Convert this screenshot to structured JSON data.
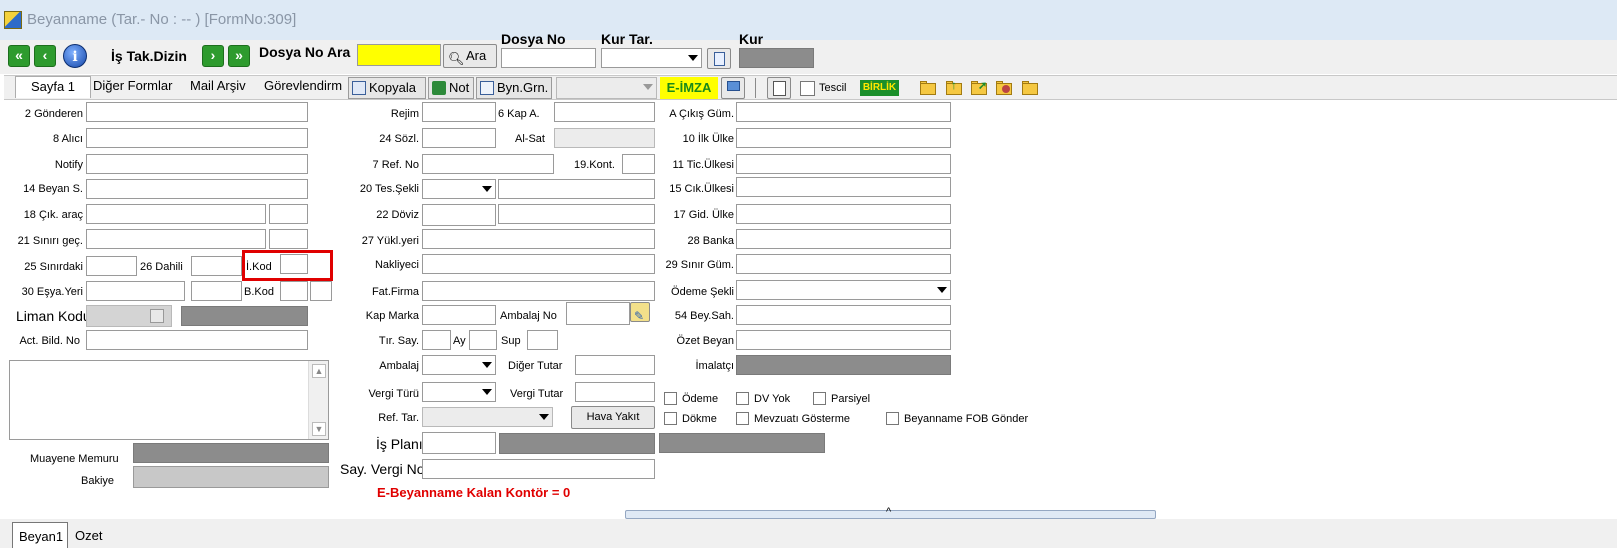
{
  "window": {
    "title": "Beyanname (Tar.- No :  --  )  [FormNo:309]",
    "app_icon_text": "ZIRS"
  },
  "toolbar": {
    "is_tak_dizin": "İş Tak.Dizin",
    "dosya_no_ara_label": "Dosya No Ara",
    "ara_button": "Ara",
    "dosya_no_label": "Dosya No",
    "kur_tar_label": "Kur Tar.",
    "kur_label": "Kur"
  },
  "tabs": [
    {
      "label": "Sayfa 1",
      "active": true
    },
    {
      "label": "Diğer Formlar",
      "active": false
    },
    {
      "label": "Mail Arşiv",
      "active": false
    },
    {
      "label": "Görevlendirm",
      "active": false
    }
  ],
  "tab_buttons": {
    "kopyala": "Kopyala",
    "not": "Not",
    "byn_grn": "Byn.Grn.",
    "eimza": "E-İMZA",
    "tescil": "Tescil",
    "birlik": "BİRLİK"
  },
  "form": {
    "left": {
      "gonderen": "2 Gönderen",
      "alici": "8 Alıcı",
      "notify": "Notify",
      "beyan_s": "14 Beyan S.",
      "cik_arac": "18 Çık. araç",
      "siniri_gec": "21 Sınırı geç.",
      "sinirdaki": "25 Sınırdaki",
      "dahili": "26 Dahili",
      "i_kod": "İ.Kod",
      "esya_yeri": "30 Eşya.Yeri",
      "b_kod": "B.Kod",
      "liman_kodu": "Liman Kodu",
      "act_bild_no": "Act. Bild. No",
      "muayene_memuru": "Muayene Memuru",
      "bakiye": "Bakiye"
    },
    "middle": {
      "rejim": "Rejim",
      "kap_a": "6 Kap A.",
      "sozl": "24 Sözl.",
      "al_sat": "Al-Sat",
      "ref_no": "7 Ref. No",
      "kont": "19.Kont.",
      "tes_sekli": "20 Tes.Şekli",
      "doviz": "22 Döviz",
      "yukl_yeri": "27 Yükl.yeri",
      "nakliyeci": "Nakliyeci",
      "fat_firma": "Fat.Firma",
      "kap_marka": "Kap Marka",
      "ambalaj_no": "Ambalaj No",
      "tir_say": "Tır. Say.",
      "ay": "Ay",
      "sup": "Sup",
      "ambalaj": "Ambalaj",
      "diger_tutar": "Diğer Tutar",
      "vergi_turu": "Vergi Türü",
      "vergi_tutar": "Vergi Tutar",
      "ref_tar": "Ref. Tar.",
      "hava_yakit": "Hava Yakıt",
      "is_plani": "İş Planı",
      "say_vergi_no": "Say. Vergi No",
      "kontor": "E-Beyanname Kalan Kontör = 0"
    },
    "right": {
      "cikis_gum": "A Çıkış Güm.",
      "ilk_ulke": "10 İlk Ülke",
      "tic_ulkesi": "11 Tic.Ülkesi",
      "cik_ulkesi": "15 Cık.Ülkesi",
      "gid_ulke": "17 Gid. Ülke",
      "banka": "28 Banka",
      "sinir_gum": "29 Sınır Güm.",
      "odeme_sekli": "Ödeme Şekli",
      "bey_sah": "54 Bey.Sah.",
      "ozet_beyan": "Özet Beyan",
      "imalatci": "İmalatçı"
    },
    "checkboxes": {
      "odeme": "Ödeme",
      "dv_yok": "DV Yok",
      "parsiyel": "Parsiyel",
      "dokme": "Dökme",
      "mevzuati": "Mevzuatı Gösterme",
      "fob": "Beyanname FOB Gönder"
    }
  },
  "bottom": {
    "tab1": "Beyan1",
    "tab2": "Ozet"
  }
}
